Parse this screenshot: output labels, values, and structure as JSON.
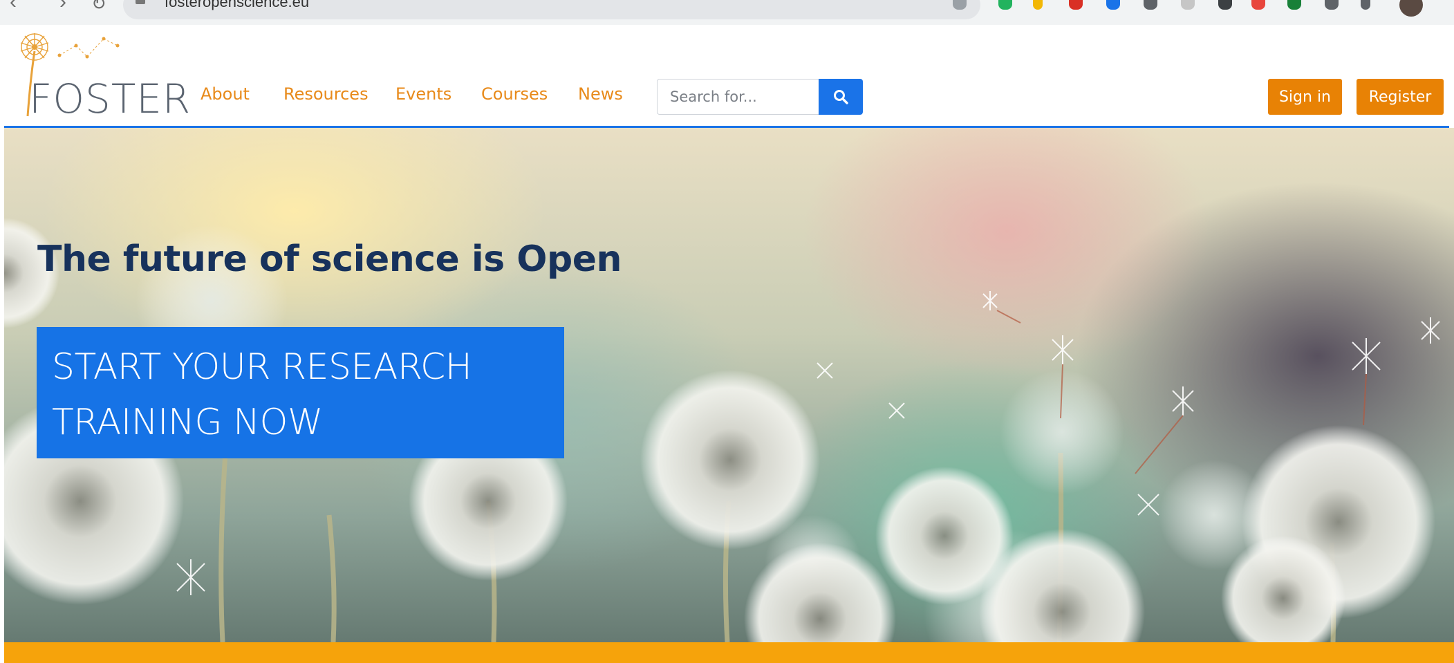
{
  "browser": {
    "url": "fosteropenscience.eu"
  },
  "brand": {
    "name": "FOSTER",
    "accent_blue": "#1a73e8",
    "accent_orange": "#e88205",
    "nav_text_color": "#e88a1a",
    "band_color": "#f6a30b"
  },
  "nav": {
    "items": [
      {
        "label": "About"
      },
      {
        "label": "Resources"
      },
      {
        "label": "Events"
      },
      {
        "label": "Courses"
      },
      {
        "label": "News"
      }
    ]
  },
  "search": {
    "placeholder": "Search for...",
    "button_icon": "search-icon"
  },
  "auth": {
    "sign_in": "Sign in",
    "register": "Register"
  },
  "hero": {
    "title": "The future of science is Open",
    "cta_line1": "START YOUR RESEARCH",
    "cta_line2": "TRAINING NOW"
  }
}
